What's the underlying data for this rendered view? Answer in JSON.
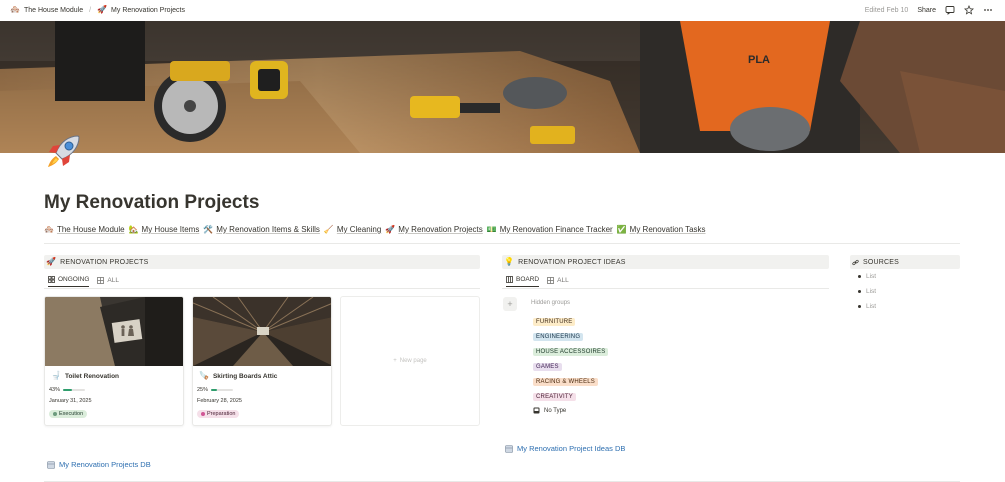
{
  "breadcrumb": {
    "items": [
      {
        "icon": "house-icon",
        "label": "The House Module"
      },
      {
        "icon": "rocket-icon",
        "label": "My Renovation Projects"
      }
    ],
    "separator": "/"
  },
  "topbar": {
    "edited": "Edited Feb 10",
    "share": "Share"
  },
  "page": {
    "title": "My Renovation Projects"
  },
  "nav_links": [
    {
      "emoji": "🏘️",
      "label": "The House Module"
    },
    {
      "emoji": "🏡",
      "label": "My House Items"
    },
    {
      "emoji": "🛠️",
      "label": "My Renovation Items & Skills"
    },
    {
      "emoji": "🧹",
      "label": "My Cleaning"
    },
    {
      "emoji": "🚀",
      "label": "My Renovation Projects"
    },
    {
      "emoji": "💵",
      "label": "My Renovation Finance Tracker"
    },
    {
      "emoji": "✅",
      "label": "My Renovation Tasks"
    }
  ],
  "projects": {
    "heading": "RENOVATION PROJECTS",
    "tabs": [
      {
        "label": "ONGOING",
        "active": true
      },
      {
        "label": "ALL",
        "active": false
      }
    ],
    "cards": [
      {
        "title": "Toilet Renovation",
        "icon": "toilet-icon",
        "progress_label": "43%",
        "progress": 0.43,
        "date": "January 31, 2025",
        "status": "Execution",
        "status_bg": "#dbeddb",
        "status_color": "#1c3829",
        "status_dot": "#6c9b7d"
      },
      {
        "title": "Skirting Boards Attic",
        "icon": "hammer-icon",
        "progress_label": "25%",
        "progress": 0.25,
        "date": "February 28, 2025",
        "status": "Preparation",
        "status_bg": "#f5e0e9",
        "status_color": "#4c2337",
        "status_dot": "#d15796"
      }
    ],
    "new_page": "New page",
    "db_link": "My Renovation Projects DB"
  },
  "ideas": {
    "heading": "RENOVATION PROJECT IDEAS",
    "tabs": [
      {
        "label": "BOARD",
        "active": true
      },
      {
        "label": "ALL",
        "active": false
      }
    ],
    "hidden_groups": "Hidden groups",
    "tags": [
      {
        "label": "FURNITURE",
        "bg": "#fdecc8",
        "color": "#402c1b"
      },
      {
        "label": "ENGINEERING",
        "bg": "#d3e5ef",
        "color": "#183347"
      },
      {
        "label": "HOUSE ACCESSOIRES",
        "bg": "#dbeddb",
        "color": "#1c3829"
      },
      {
        "label": "GAMES",
        "bg": "#e8deee",
        "color": "#412454"
      },
      {
        "label": "RACING & WHEELS",
        "bg": "#fadec9",
        "color": "#49290e"
      },
      {
        "label": "CREATIVITY",
        "bg": "#f5e0e9",
        "color": "#4c2337"
      }
    ],
    "no_type": "No Type",
    "db_link": "My Renovation Project Ideas DB"
  },
  "sources": {
    "heading": "SOURCES",
    "items": [
      "List",
      "List",
      "List"
    ]
  }
}
